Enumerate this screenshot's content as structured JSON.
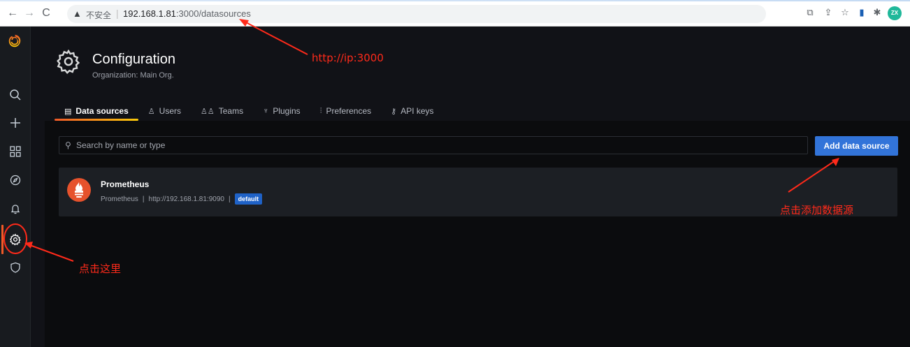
{
  "browser": {
    "insecure_label": "不安全",
    "url_host": "192.168.1.81",
    "url_rest": ":3000/datasources",
    "profile_initials": "ZX"
  },
  "header": {
    "title": "Configuration",
    "subtitle": "Organization: Main Org."
  },
  "tabs": [
    {
      "label": "Data sources",
      "icon": "database-icon",
      "active": true
    },
    {
      "label": "Users",
      "icon": "user-icon"
    },
    {
      "label": "Teams",
      "icon": "users-icon"
    },
    {
      "label": "Plugins",
      "icon": "plug-icon"
    },
    {
      "label": "Preferences",
      "icon": "sliders-icon"
    },
    {
      "label": "API keys",
      "icon": "key-icon"
    }
  ],
  "search": {
    "placeholder": "Search by name or type"
  },
  "add_button": {
    "label": "Add data source"
  },
  "datasource": {
    "name": "Prometheus",
    "type": "Prometheus",
    "url": "http://192.168.1.81:9090",
    "badge": "default"
  },
  "annotations": {
    "url_note": "http://ip:3000",
    "add_note": "点击添加数据源",
    "gear_note": "点击这里"
  },
  "colors": {
    "accent": "#f05a28",
    "primary": "#3274d9",
    "annotation": "#ff2a1a"
  }
}
